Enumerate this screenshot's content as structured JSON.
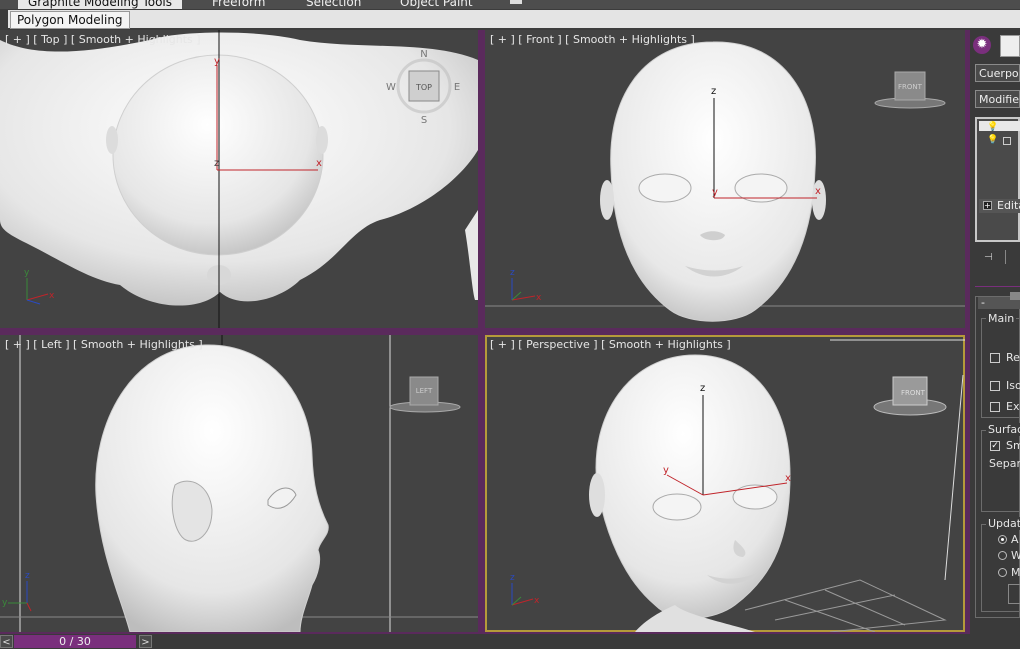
{
  "ribbon": {
    "tabs": [
      "Graphite Modeling Tools",
      "Freeform",
      "Selection",
      "Object Paint"
    ],
    "sub_tab": "Polygon Modeling"
  },
  "viewports": {
    "top_left": {
      "label": "[ + ] [ Top ] [ Smooth + Highlights ]",
      "viewcube": "TOP",
      "compass": [
        "N",
        "E",
        "S",
        "W"
      ]
    },
    "front": {
      "label": "[ + ] [ Front ] [ Smooth + Highlights ]",
      "viewcube": "FRONT"
    },
    "left": {
      "label": "[ + ] [ Left ] [ Smooth + Highlights ]",
      "viewcube": "LEFT"
    },
    "perspective": {
      "label": "[ + ] [ Perspective ] [ Smooth + Highlights ]",
      "viewcube": "FRONT"
    }
  },
  "axes": {
    "x": "x",
    "y": "y",
    "z": "z"
  },
  "timeline": {
    "prev": "<",
    "frame": "0 / 30",
    "next": ">"
  },
  "command_panel": {
    "object_name": "Cuerpo",
    "modifier_list": "Modifier",
    "stack_item": "Edita",
    "rollout_minus": "-",
    "rollout_main": "Main",
    "options": [
      "Re",
      "Iso",
      "Ex"
    ],
    "surface_group": "Surfac",
    "smooth": "Sm",
    "separate": "Separa",
    "update_group": "Update",
    "update_options": [
      "A",
      "W",
      "M"
    ]
  },
  "colors": {
    "viewport_bg": "#434343",
    "viewport_border": "#7a2f7d",
    "active_border": "#b59a3a",
    "gizmo": "#c0242a"
  }
}
